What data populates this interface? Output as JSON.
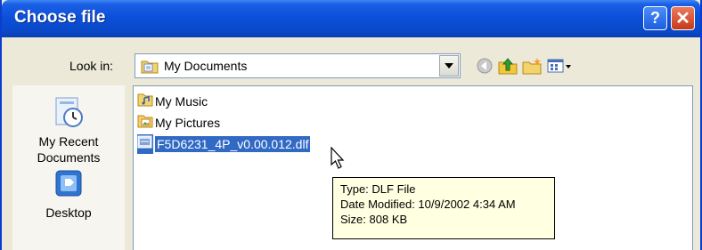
{
  "window": {
    "title": "Choose file",
    "help_glyph": "?",
    "close_glyph": "✕"
  },
  "lookin": {
    "label": "Look in:",
    "value": "My Documents"
  },
  "toolbar": {
    "icons": [
      "back-icon",
      "up-folder-icon",
      "new-folder-icon",
      "view-menu-icon"
    ]
  },
  "places": [
    {
      "label": "My Recent Documents",
      "icon": "recent-documents-icon"
    },
    {
      "label": "Desktop",
      "icon": "desktop-icon"
    }
  ],
  "files": [
    {
      "name": "My Music",
      "icon": "music-folder-icon",
      "selected": false
    },
    {
      "name": "My Pictures",
      "icon": "pictures-folder-icon",
      "selected": false
    },
    {
      "name": "F5D6231_4P_v0.00.012.dlf",
      "icon": "dlf-file-icon",
      "selected": true
    }
  ],
  "tooltip": {
    "type": "Type: DLF File",
    "date": "Date Modified: 10/9/2002 4:34 AM",
    "size": "Size: 808 KB"
  },
  "colors": {
    "titlebar": "#0b4fd8",
    "selection": "#316ac5",
    "tooltip_bg": "#ffffe1",
    "close_button": "#c43a1a"
  }
}
